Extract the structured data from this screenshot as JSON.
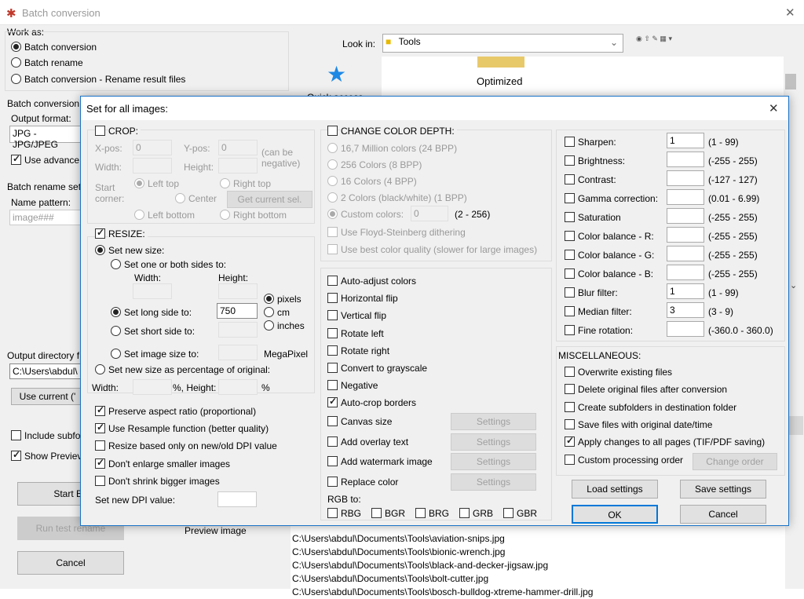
{
  "main": {
    "title": "Batch conversion",
    "work_as": "Work as:",
    "mode_options": [
      "Batch conversion",
      "Batch rename",
      "Batch conversion - Rename result files"
    ],
    "batch_conversion_settings": "Batch conversion",
    "output_format": "Output format:",
    "output_format_value": "JPG - JPG/JPEG",
    "use_advanced": "Use advance",
    "batch_rename_settings": "Batch rename set",
    "name_pattern": "Name pattern:",
    "name_pattern_value": "image###",
    "output_dir": "Output directory f",
    "output_dir_value": "C:\\Users\\abdul\\",
    "use_current": "Use current ('",
    "include_subfolders": "Include subfo",
    "show_preview": "Show Previev",
    "start_batch": "Start Ba",
    "run_test_rename": "Run test rename",
    "cancel": "Cancel",
    "look_in": "Look in:",
    "look_in_value": "Tools",
    "quick_access": "Quick access",
    "folder_label": "Optimized",
    "preview_image": "Preview image",
    "files": [
      "C:\\Users\\abdul\\Documents\\Tools\\aviation-snips.jpg",
      "C:\\Users\\abdul\\Documents\\Tools\\bionic-wrench.jpg",
      "C:\\Users\\abdul\\Documents\\Tools\\black-and-decker-jigsaw.jpg",
      "C:\\Users\\abdul\\Documents\\Tools\\bolt-cutter.jpg",
      "C:\\Users\\abdul\\Documents\\Tools\\bosch-bulldog-xtreme-hammer-drill.jpg"
    ]
  },
  "dialog": {
    "title": "Set for all images:",
    "crop": {
      "label": "CROP:",
      "xpos": "X-pos:",
      "xpos_value": "0",
      "ypos": "Y-pos:",
      "ypos_value": "0",
      "can_be_negative": "(can be\nnegative)",
      "width": "Width:",
      "height": "Height:",
      "start_corner": "Start\ncorner:",
      "left_top": "Left top",
      "right_top": "Right top",
      "center": "Center",
      "get_current_sel": "Get current sel.",
      "left_bottom": "Left bottom",
      "right_bottom": "Right bottom"
    },
    "resize": {
      "label": "RESIZE:",
      "set_new_size": "Set new size:",
      "one_or_both": "Set one or both sides to:",
      "width": "Width:",
      "height": "Height:",
      "long_side": "Set long side to:",
      "long_side_value": "750",
      "short_side": "Set short side to:",
      "image_size": "Set image size to:",
      "megapixel": "MegaPixel",
      "units": [
        "pixels",
        "cm",
        "inches"
      ],
      "percentage": "Set new size as percentage of original:",
      "pct_width": "Width:",
      "pct_height": "%, Height:",
      "pct": "%",
      "preserve": "Preserve aspect ratio (proportional)",
      "resample": "Use Resample function (better quality)",
      "dpi_only": "Resize based only on new/old DPI value",
      "dont_enlarge": "Don't enlarge smaller images",
      "dont_shrink": "Don't shrink bigger images",
      "dpi_value": "Set new DPI value:"
    },
    "color_depth": {
      "label": "CHANGE COLOR DEPTH:",
      "options": [
        "16,7 Million colors (24 BPP)",
        "256 Colors (8 BPP)",
        "16 Colors (4 BPP)",
        "2 Colors (black/white) (1 BPP)"
      ],
      "custom": "Custom colors:",
      "custom_value": "0",
      "custom_range": "(2 - 256)",
      "floyd": "Use Floyd-Steinberg dithering",
      "best_quality": "Use best color quality (slower for large images)"
    },
    "transforms": [
      "Auto-adjust colors",
      "Horizontal flip",
      "Vertical flip",
      "Rotate left",
      "Rotate right",
      "Convert to grayscale",
      "Negative",
      "Auto-crop borders"
    ],
    "with_settings": [
      "Canvas size",
      "Add overlay text",
      "Add watermark image",
      "Replace color"
    ],
    "settings": "Settings",
    "rgb_to": "RGB to:",
    "rgb_options": [
      "RBG",
      "BGR",
      "BRG",
      "GRB",
      "GBR"
    ],
    "adjust": [
      {
        "label": "Sharpen:",
        "value": "1",
        "range": "(1  -  99)"
      },
      {
        "label": "Brightness:",
        "value": "",
        "range": "(-255  -  255)"
      },
      {
        "label": "Contrast:",
        "value": "",
        "range": "(-127  -  127)"
      },
      {
        "label": "Gamma correction:",
        "value": "",
        "range": "(0.01  -  6.99)"
      },
      {
        "label": "Saturation",
        "value": "",
        "range": "(-255  -  255)"
      },
      {
        "label": "Color balance - R:",
        "value": "",
        "range": "(-255  -  255)"
      },
      {
        "label": "Color balance - G:",
        "value": "",
        "range": "(-255  -  255)"
      },
      {
        "label": "Color balance - B:",
        "value": "",
        "range": "(-255  -  255)"
      },
      {
        "label": "Blur filter:",
        "value": "1",
        "range": "(1  -  99)"
      },
      {
        "label": "Median filter:",
        "value": "3",
        "range": "(3  -  9)"
      },
      {
        "label": "Fine rotation:",
        "value": "",
        "range": "(-360.0  -  360.0)"
      }
    ],
    "misc": {
      "label": "MISCELLANEOUS:",
      "items": [
        "Overwrite existing files",
        "Delete original files after conversion",
        "Create subfolders in destination folder",
        "Save files with original date/time",
        "Apply changes to all pages (TIF/PDF saving)",
        "Custom processing order"
      ],
      "change_order": "Change order"
    },
    "load_settings": "Load settings",
    "save_settings": "Save settings",
    "ok": "OK",
    "cancel": "Cancel"
  }
}
